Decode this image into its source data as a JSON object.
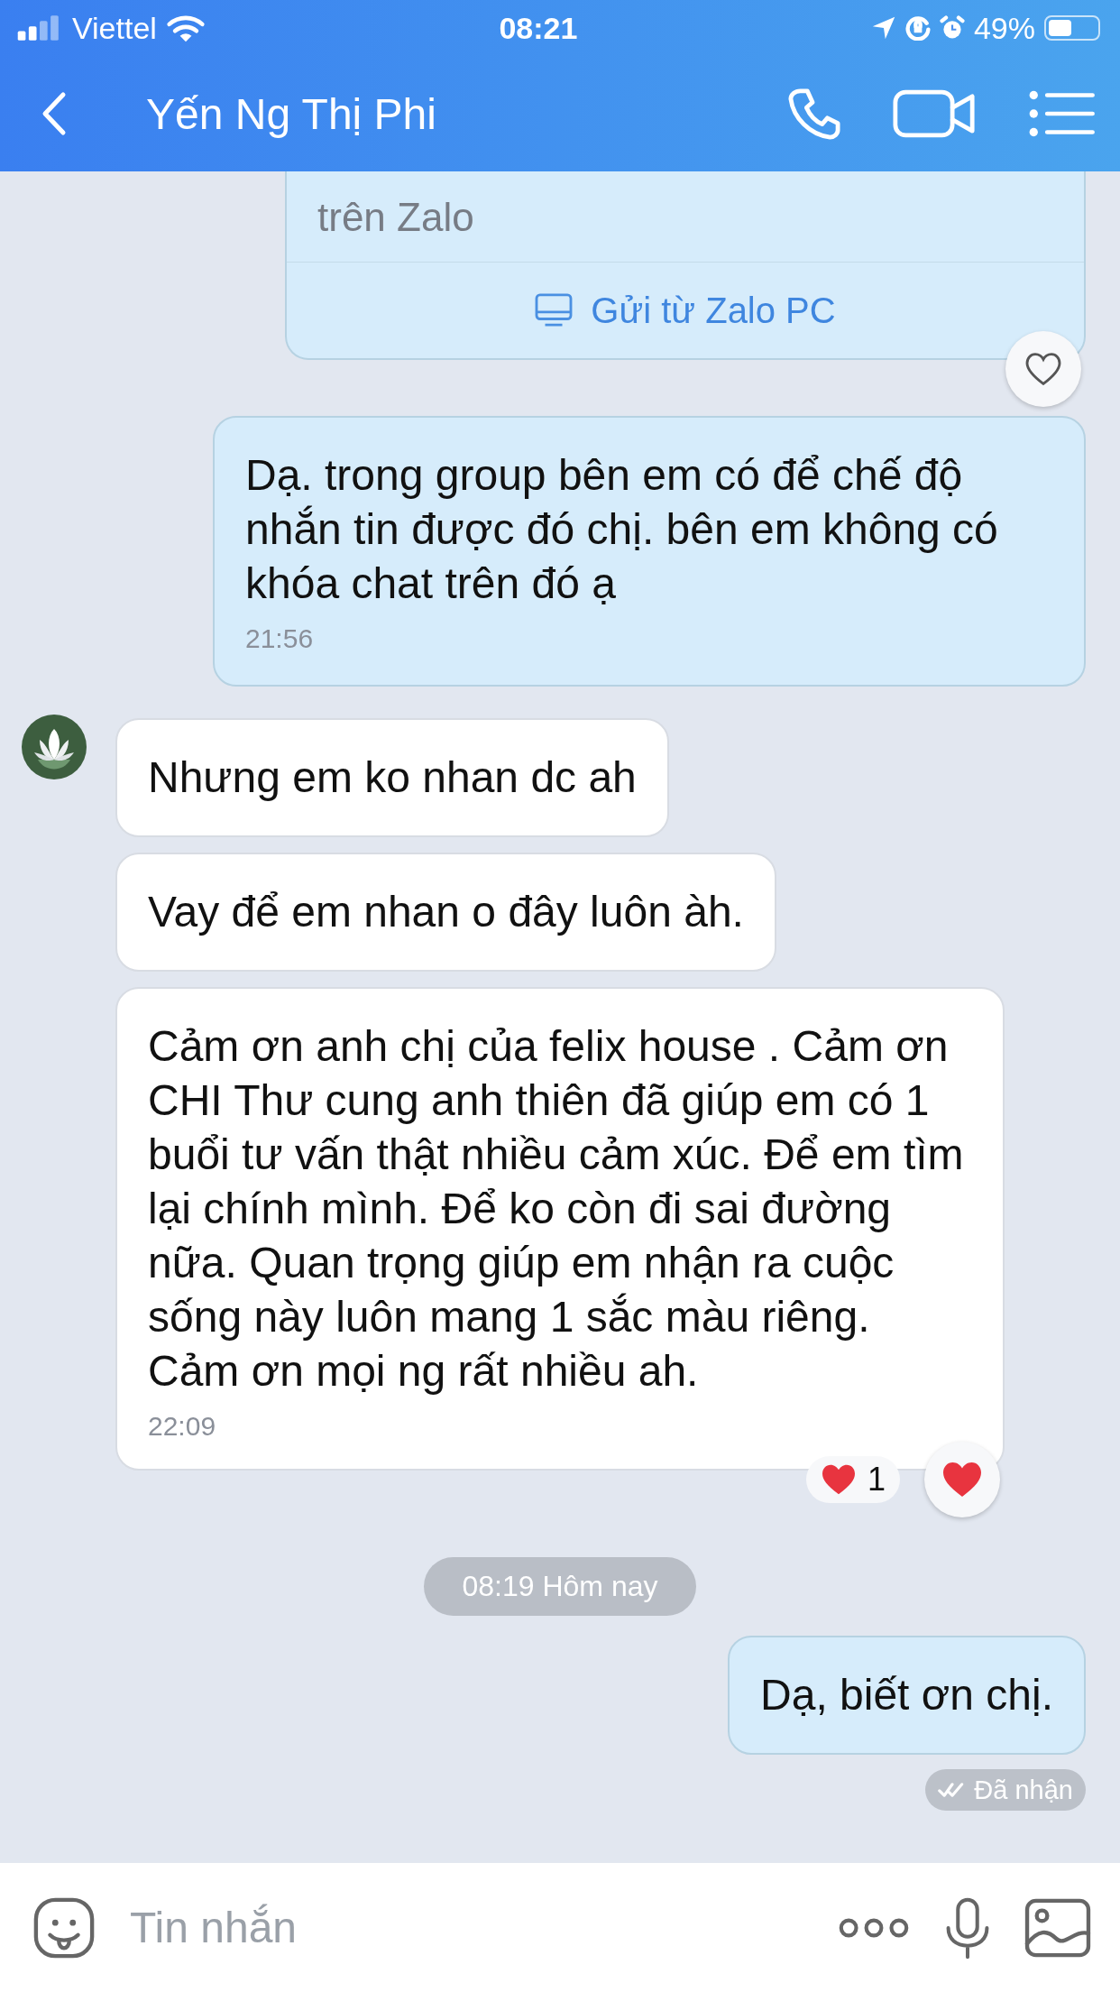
{
  "status_bar": {
    "carrier": "Viettel",
    "time": "08:21",
    "battery": "49%"
  },
  "header": {
    "title": "Yến Ng Thị Phi"
  },
  "messages": [
    {
      "kind": "card",
      "lines": [
        "trên Zalo"
      ],
      "footer": "Gửi từ Zalo PC",
      "reacted": false
    },
    {
      "kind": "sent",
      "text": "Dạ. trong group bên em có để chế độ nhắn tin được đó chị. bên em không có khóa chat trên đó ạ",
      "time": "21:56"
    },
    {
      "kind": "received",
      "avatar": true,
      "text": "Nhưng em ko nhan dc ah"
    },
    {
      "kind": "received",
      "avatar": false,
      "text": "Vay để em nhan o đây luôn àh."
    },
    {
      "kind": "received",
      "avatar": false,
      "text": "Cảm ơn anh chị của felix house . Cảm ơn CHI Thư cung anh thiên đã giúp em có 1 buổi tư vấn thật nhiều cảm xúc.  Để em tìm lại chính mình. Để ko còn đi sai đường nữa.  Quan trọng giúp em nhận ra cuộc sống này luôn mang 1 sắc màu riêng.  Cảm ơn mọi ng rất nhiều ah.",
      "time": "22:09",
      "reaction_count": "1",
      "reacted": true
    },
    {
      "kind": "date",
      "text": "08:19 Hôm nay"
    },
    {
      "kind": "sent",
      "text": "Dạ, biết ơn chị."
    },
    {
      "kind": "status",
      "text": "Đã nhận"
    }
  ],
  "composer": {
    "placeholder": "Tin nhắn"
  }
}
